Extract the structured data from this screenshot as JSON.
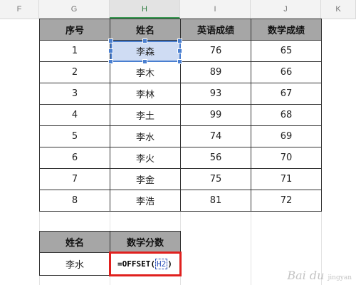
{
  "columns": [
    "F",
    "G",
    "H",
    "I",
    "J",
    "K"
  ],
  "main_table": {
    "headers": [
      "序号",
      "姓名",
      "英语成绩",
      "数学成绩"
    ],
    "rows": [
      [
        "1",
        "李森",
        "76",
        "65"
      ],
      [
        "2",
        "李木",
        "89",
        "66"
      ],
      [
        "3",
        "李林",
        "93",
        "67"
      ],
      [
        "4",
        "李土",
        "99",
        "68"
      ],
      [
        "5",
        "李水",
        "74",
        "69"
      ],
      [
        "6",
        "李火",
        "56",
        "70"
      ],
      [
        "7",
        "李金",
        "75",
        "71"
      ],
      [
        "8",
        "李浩",
        "81",
        "72"
      ]
    ]
  },
  "lookup_table": {
    "headers": [
      "姓名",
      "数学分数"
    ],
    "name_value": "李水",
    "formula_prefix": "=OFFSET(",
    "formula_ref": "H2",
    "formula_suffix": ")"
  },
  "colors": {
    "header_fill": "#a6a6a6",
    "selection_fill": "#cfdcf3",
    "selection_border": "#4a7fd0",
    "formula_highlight": "#e0201e",
    "active_column": "#3c9a54"
  },
  "watermark": {
    "text": "Bai du",
    "sub": "jingyan"
  }
}
